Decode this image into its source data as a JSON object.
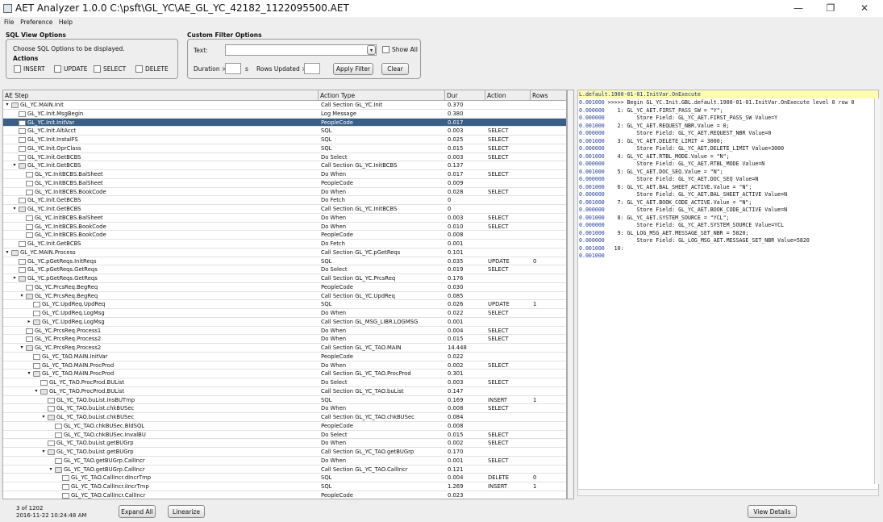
{
  "window": {
    "title": "AET Analyzer 1.0.0  C:\\psft\\GL_YC\\AE_GL_YC_42182_1122095500.AET",
    "minimize": "—",
    "maximize": "❐",
    "close": "✕"
  },
  "menu": [
    "File",
    "Preference",
    "Help"
  ],
  "sql_options": {
    "title": "SQL View Options",
    "hint": "Choose SQL Options to be displayed.",
    "actions_label": "Actions",
    "checks": [
      "INSERT",
      "UPDATE",
      "SELECT",
      "DELETE"
    ]
  },
  "filter": {
    "title": "Custom Filter Options",
    "text_label": "Text:",
    "show_all": "Show All",
    "duration_label": "Duration >",
    "duration_unit": "s",
    "rows_label": "Rows Updated >",
    "apply": "Apply Filter",
    "clear": "Clear"
  },
  "columns": [
    "AE Step",
    "Action Type",
    "Dur",
    "Action",
    "Rows"
  ],
  "rows": [
    {
      "d": 0,
      "t": "GL_YC.MAIN.Init",
      "a": "Call Section GL_YC.Init",
      "dur": "0.370",
      "act": "",
      "r": "",
      "x": "▾",
      "f": true,
      "s": false
    },
    {
      "d": 1,
      "t": "GL_YC.Init.MsgBegin",
      "a": "Log Message",
      "dur": "0.380",
      "act": "",
      "r": "",
      "x": "",
      "f": false,
      "s": false
    },
    {
      "d": 1,
      "t": "GL_YC.Init.InitVar",
      "a": "PeopleCode",
      "dur": "0.017",
      "act": "",
      "r": "",
      "x": "",
      "f": false,
      "s": true
    },
    {
      "d": 1,
      "t": "GL_YC.Init.AltAcct",
      "a": "SQL",
      "dur": "0.003",
      "act": "SELECT",
      "r": "",
      "x": "",
      "f": false,
      "s": false
    },
    {
      "d": 1,
      "t": "GL_YC.Init.InstalFS",
      "a": "SQL",
      "dur": "0.025",
      "act": "SELECT",
      "r": "",
      "x": "",
      "f": false,
      "s": false
    },
    {
      "d": 1,
      "t": "GL_YC.Init.OprClass",
      "a": "SQL",
      "dur": "0.015",
      "act": "SELECT",
      "r": "",
      "x": "",
      "f": false,
      "s": false
    },
    {
      "d": 1,
      "t": "GL_YC.Init.GetBCBS",
      "a": "Do Select",
      "dur": "0.003",
      "act": "SELECT",
      "r": "",
      "x": "",
      "f": false,
      "s": false
    },
    {
      "d": 1,
      "t": "GL_YC.Init.GetBCBS",
      "a": "Call Section GL_YC.InitBCBS",
      "dur": "0.137",
      "act": "",
      "r": "",
      "x": "▾",
      "f": true,
      "s": false
    },
    {
      "d": 2,
      "t": "GL_YC.InitBCBS.BalSheet",
      "a": "Do When",
      "dur": "0.017",
      "act": "SELECT",
      "r": "",
      "x": "",
      "f": false,
      "s": false
    },
    {
      "d": 2,
      "t": "GL_YC.InitBCBS.BalSheet",
      "a": "PeopleCode",
      "dur": "0.009",
      "act": "",
      "r": "",
      "x": "",
      "f": false,
      "s": false
    },
    {
      "d": 2,
      "t": "GL_YC.InitBCBS.BookCode",
      "a": "Do When",
      "dur": "0.028",
      "act": "SELECT",
      "r": "",
      "x": "",
      "f": false,
      "s": false
    },
    {
      "d": 1,
      "t": "GL_YC.Init.GetBCBS",
      "a": "Do Fetch",
      "dur": "0",
      "act": "",
      "r": "",
      "x": "",
      "f": false,
      "s": false
    },
    {
      "d": 1,
      "t": "GL_YC.Init.GetBCBS",
      "a": "Call Section GL_YC.InitBCBS",
      "dur": "0",
      "act": "",
      "r": "",
      "x": "▾",
      "f": true,
      "s": false
    },
    {
      "d": 2,
      "t": "GL_YC.InitBCBS.BalSheet",
      "a": "Do When",
      "dur": "0.003",
      "act": "SELECT",
      "r": "",
      "x": "",
      "f": false,
      "s": false
    },
    {
      "d": 2,
      "t": "GL_YC.InitBCBS.BookCode",
      "a": "Do When",
      "dur": "0.010",
      "act": "SELECT",
      "r": "",
      "x": "",
      "f": false,
      "s": false
    },
    {
      "d": 2,
      "t": "GL_YC.InitBCBS.BookCode",
      "a": "PeopleCode",
      "dur": "0.008",
      "act": "",
      "r": "",
      "x": "",
      "f": false,
      "s": false
    },
    {
      "d": 1,
      "t": "GL_YC.Init.GetBCBS",
      "a": "Do Fetch",
      "dur": "0.001",
      "act": "",
      "r": "",
      "x": "",
      "f": false,
      "s": false
    },
    {
      "d": 0,
      "t": "GL_YC.MAIN.Process",
      "a": "Call Section GL_YC.pGetReqs",
      "dur": "0.101",
      "act": "",
      "r": "",
      "x": "▾",
      "f": true,
      "s": false
    },
    {
      "d": 1,
      "t": "GL_YC.pGetReqs.InitReqs",
      "a": "SQL",
      "dur": "0.035",
      "act": "UPDATE",
      "r": "0",
      "x": "",
      "f": false,
      "s": false
    },
    {
      "d": 1,
      "t": "GL_YC.pGetReqs.GetReqs",
      "a": "Do Select",
      "dur": "0.019",
      "act": "SELECT",
      "r": "",
      "x": "",
      "f": false,
      "s": false
    },
    {
      "d": 1,
      "t": "GL_YC.pGetReqs.GetReqs",
      "a": "Call Section GL_YC.PrcsReq",
      "dur": "0.176",
      "act": "",
      "r": "",
      "x": "▾",
      "f": true,
      "s": false
    },
    {
      "d": 2,
      "t": "GL_YC.PrcsReq.BegReq",
      "a": "PeopleCode",
      "dur": "0.030",
      "act": "",
      "r": "",
      "x": "",
      "f": false,
      "s": false
    },
    {
      "d": 2,
      "t": "GL_YC.PrcsReq.BegReq",
      "a": "Call Section GL_YC.UpdReq",
      "dur": "0.085",
      "act": "",
      "r": "",
      "x": "▾",
      "f": true,
      "s": false
    },
    {
      "d": 3,
      "t": "GL_YC.UpdReq.UpdReq",
      "a": "SQL",
      "dur": "0.026",
      "act": "UPDATE",
      "r": "1",
      "x": "",
      "f": false,
      "s": false
    },
    {
      "d": 3,
      "t": "GL_YC.UpdReq.LogMsg",
      "a": "Do When",
      "dur": "0.022",
      "act": "SELECT",
      "r": "",
      "x": "",
      "f": false,
      "s": false
    },
    {
      "d": 3,
      "t": "GL_YC.UpdReq.LogMsg",
      "a": "Call Section GL_MSG_LIBR.LOGMSG",
      "dur": "0.001",
      "act": "",
      "r": "",
      "x": "▸",
      "f": true,
      "s": false
    },
    {
      "d": 2,
      "t": "GL_YC.PrcsReq.Process1",
      "a": "Do When",
      "dur": "0.004",
      "act": "SELECT",
      "r": "",
      "x": "",
      "f": false,
      "s": false
    },
    {
      "d": 2,
      "t": "GL_YC.PrcsReq.Process2",
      "a": "Do When",
      "dur": "0.015",
      "act": "SELECT",
      "r": "",
      "x": "",
      "f": false,
      "s": false
    },
    {
      "d": 2,
      "t": "GL_YC.PrcsReq.Process2",
      "a": "Call Section GL_YC_TAO.MAIN",
      "dur": "14.448",
      "act": "",
      "r": "",
      "x": "▾",
      "f": true,
      "s": false
    },
    {
      "d": 3,
      "t": "GL_YC_TAO.MAIN.InitVar",
      "a": "PeopleCode",
      "dur": "0.022",
      "act": "",
      "r": "",
      "x": "",
      "f": false,
      "s": false
    },
    {
      "d": 3,
      "t": "GL_YC_TAO.MAIN.ProcProd",
      "a": "Do When",
      "dur": "0.002",
      "act": "SELECT",
      "r": "",
      "x": "",
      "f": false,
      "s": false
    },
    {
      "d": 3,
      "t": "GL_YC_TAO.MAIN.ProcProd",
      "a": "Call Section GL_YC_TAO.ProcProd",
      "dur": "0.301",
      "act": "",
      "r": "",
      "x": "▾",
      "f": true,
      "s": false
    },
    {
      "d": 4,
      "t": "GL_YC_TAO.ProcProd.BUList",
      "a": "Do Select",
      "dur": "0.003",
      "act": "SELECT",
      "r": "",
      "x": "",
      "f": false,
      "s": false
    },
    {
      "d": 4,
      "t": "GL_YC_TAO.ProcProd.BUList",
      "a": "Call Section GL_YC_TAO.buList",
      "dur": "0.147",
      "act": "",
      "r": "",
      "x": "▾",
      "f": true,
      "s": false
    },
    {
      "d": 5,
      "t": "GL_YC_TAO.buList.InsBUTmp",
      "a": "SQL",
      "dur": "0.169",
      "act": "INSERT",
      "r": "1",
      "x": "",
      "f": false,
      "s": false
    },
    {
      "d": 5,
      "t": "GL_YC_TAO.buList.chkBUSec",
      "a": "Do When",
      "dur": "0.008",
      "act": "SELECT",
      "r": "",
      "x": "",
      "f": false,
      "s": false
    },
    {
      "d": 5,
      "t": "GL_YC_TAO.buList.chkBUSec",
      "a": "Call Section GL_YC_TAO.chkBUSec",
      "dur": "0.084",
      "act": "",
      "r": "",
      "x": "▾",
      "f": true,
      "s": false
    },
    {
      "d": 6,
      "t": "GL_YC_TAO.chkBUSec.BldSQL",
      "a": "PeopleCode",
      "dur": "0.008",
      "act": "",
      "r": "",
      "x": "",
      "f": false,
      "s": false
    },
    {
      "d": 6,
      "t": "GL_YC_TAO.chkBUSec.InvalBU",
      "a": "Do Select",
      "dur": "0.015",
      "act": "SELECT",
      "r": "",
      "x": "",
      "f": false,
      "s": false
    },
    {
      "d": 5,
      "t": "GL_YC_TAO.buList.getBUGrp",
      "a": "Do When",
      "dur": "0.002",
      "act": "SELECT",
      "r": "",
      "x": "",
      "f": false,
      "s": false
    },
    {
      "d": 5,
      "t": "GL_YC_TAO.buList.getBUGrp",
      "a": "Call Section GL_YC_TAO.getBUGrp",
      "dur": "0.170",
      "act": "",
      "r": "",
      "x": "▾",
      "f": true,
      "s": false
    },
    {
      "d": 6,
      "t": "GL_YC_TAO.getBUGrp.CallIncr",
      "a": "Do When",
      "dur": "0.001",
      "act": "SELECT",
      "r": "",
      "x": "",
      "f": false,
      "s": false
    },
    {
      "d": 6,
      "t": "GL_YC_TAO.getBUGrp.CallIncr",
      "a": "Call Section GL_YC_TAO.CallIncr",
      "dur": "0.121",
      "act": "",
      "r": "",
      "x": "▾",
      "f": true,
      "s": false
    },
    {
      "d": 7,
      "t": "GL_YC_TAO.CallIncr.dIncrTmp",
      "a": "SQL",
      "dur": "0.004",
      "act": "DELETE",
      "r": "0",
      "x": "",
      "f": false,
      "s": false
    },
    {
      "d": 7,
      "t": "GL_YC_TAO.CallIncr.iIncrTmp",
      "a": "SQL",
      "dur": "1.269",
      "act": "INSERT",
      "r": "1",
      "x": "",
      "f": false,
      "s": false
    },
    {
      "d": 7,
      "t": "GL_YC_TAO.CallIncr.CallIncr",
      "a": "PeopleCode",
      "dur": "0.023",
      "act": "",
      "r": "",
      "x": "",
      "f": false,
      "s": false
    }
  ],
  "detail": {
    "header": "L.default.1900-01-01.InitVar.OnExecute",
    "lines": [
      [
        "0.001000",
        " >>>>> Begin GL_YC.Init.GBL.default.1900-01-01.InitVar.OnExecute level 0 row 0"
      ],
      [
        "0.000000",
        "    1: GL_YC_AET.FIRST_PASS_SW = \"Y\";"
      ],
      [
        "0.000000",
        "          Store Field: GL_YC_AET.FIRST_PASS_SW Value=Y"
      ],
      [
        "0.001000",
        "    2: GL_YC_AET.REQUEST_NBR.Value = 0;"
      ],
      [
        "0.000000",
        "          Store Field: GL_YC_AET.REQUEST_NBR Value=0"
      ],
      [
        "0.001000",
        "    3: GL_YC_AET.DELETE_LIMIT = 3000;"
      ],
      [
        "0.000000",
        "          Store Field: GL_YC_AET.DELETE_LIMIT Value=3000"
      ],
      [
        "0.001000",
        "    4: GL_YC_AET.RTBL_MODE.Value = \"N\";"
      ],
      [
        "0.000000",
        "          Store Field: GL_YC_AET.RTBL_MODE Value=N"
      ],
      [
        "0.001000",
        "    5: GL_YC_AET.DOC_SEQ.Value = \"N\";"
      ],
      [
        "0.000000",
        "          Store Field: GL_YC_AET.DOC_SEQ Value=N"
      ],
      [
        "0.001000",
        "    6: GL_YC_AET.BAL_SHEET_ACTIVE.Value = \"N\";"
      ],
      [
        "0.000000",
        "          Store Field: GL_YC_AET.BAL_SHEET_ACTIVE Value=N"
      ],
      [
        "0.001000",
        "    7: GL_YC_AET.BOOK_CODE_ACTIVE.Value = \"N\";"
      ],
      [
        "0.000000",
        "          Store Field: GL_YC_AET.BOOK_CODE_ACTIVE Value=N"
      ],
      [
        "0.001000",
        "    8: GL_YC_AET.SYSTEM_SOURCE = \"YCL\";"
      ],
      [
        "0.000000",
        "          Store Field: GL_YC_AET.SYSTEM_SOURCE Value=YCL"
      ],
      [
        "0.001000",
        "    9: GL_LOG_MSG_AET.MESSAGE_SET_NBR = 5820;"
      ],
      [
        "0.000000",
        "          Store Field: GL_LOG_MSG_AET.MESSAGE_SET_NBR Value=5820"
      ],
      [
        "0.001000",
        "   10:"
      ],
      [
        "0.001000",
        ""
      ]
    ]
  },
  "status": {
    "count": "3 of 1202",
    "date": "2016-11-22 10:24:48 AM"
  },
  "buttons": {
    "expand_all": "Expand All",
    "linearize": "Linearize",
    "view_details": "View Details"
  }
}
